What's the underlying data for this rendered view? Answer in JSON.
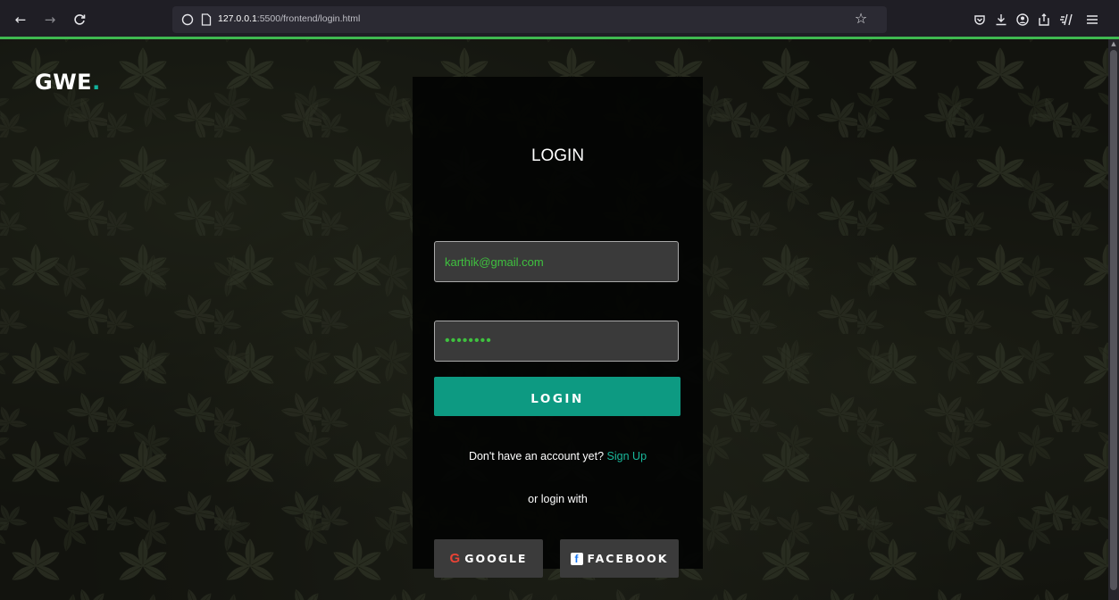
{
  "browser": {
    "back_icon": "←",
    "forward_icon": "→",
    "reload_icon": "C",
    "url_host": "127.0.0.1",
    "url_rest": ":5500/frontend/login.html",
    "bookmark_icon": "☆",
    "toolbar_icons": [
      "pocket-icon",
      "download-icon",
      "account-icon",
      "share-icon",
      "reader-icon",
      "menu-icon"
    ]
  },
  "logo": {
    "text": "GWE",
    "dot": "."
  },
  "login": {
    "title": "LOGIN",
    "email_value": "karthik@gmail.com",
    "password_value": "••••••••",
    "button_label": "LOGIN",
    "signup_prompt": "Don't have an account yet?",
    "signup_link": "Sign Up",
    "alt_login_text": "or login with",
    "google_label": "GOOGLE",
    "facebook_label": "FACEBOOK"
  },
  "colors": {
    "accent": "#0d9a82",
    "link": "#19b79b",
    "input_text": "#3fc13f",
    "loading_bar": "#3fb950"
  }
}
